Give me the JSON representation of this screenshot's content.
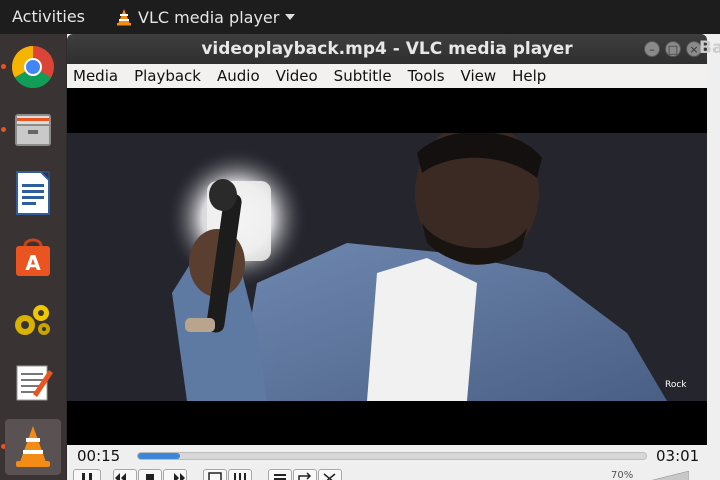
{
  "topbar": {
    "activities_label": "Activities",
    "app_menu_label": "VLC media player"
  },
  "dock": {
    "items": [
      "chrome",
      "files",
      "writer",
      "software",
      "settings",
      "text-editor",
      "vlc"
    ],
    "accent_color": "#e95420"
  },
  "window": {
    "title": "videoplayback.mp4 - VLC media player",
    "partial_next_window_letter": "Ba"
  },
  "menubar": {
    "items": [
      "Media",
      "Playback",
      "Audio",
      "Video",
      "Subtitle",
      "Tools",
      "View",
      "Help"
    ]
  },
  "video": {
    "watermark": "Rock"
  },
  "seek": {
    "elapsed": "00:15",
    "total": "03:01",
    "progress_fraction": 0.083,
    "fill_color": "#3d86d8"
  },
  "volume": {
    "label": "70%"
  }
}
